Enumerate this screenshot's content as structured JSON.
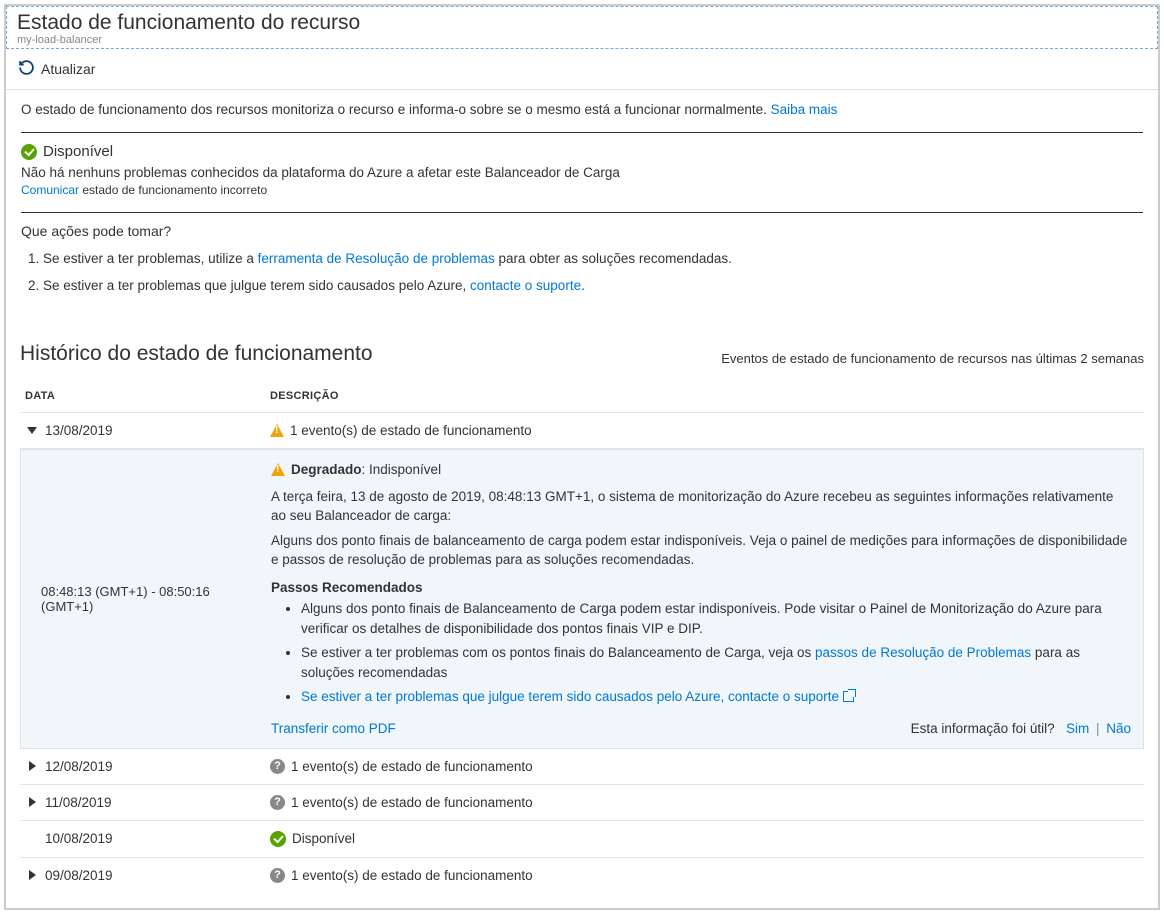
{
  "header": {
    "title": "Estado de funcionamento do recurso",
    "subtitle": "my-load-balancer"
  },
  "toolbar": {
    "refresh": "Atualizar"
  },
  "intro": {
    "text": "O estado de funcionamento dos recursos monitoriza o recurso e informa-o sobre se o mesmo está a funcionar normalmente. ",
    "learn_more": "Saiba mais"
  },
  "status": {
    "label": "Disponível",
    "description": "Não há nenhuns problemas conhecidos da plataforma do Azure a afetar este Balanceador de Carga",
    "report_link": "Comunicar",
    "report_suffix": " estado de funcionamento incorreto"
  },
  "actions": {
    "question": "Que ações pode tomar?",
    "items": [
      {
        "prefix": "Se estiver a ter problemas, utilize a ",
        "link": "ferramenta de Resolução de problemas",
        "suffix": " para obter as soluções recomendadas."
      },
      {
        "prefix": "Se estiver a ter problemas que julgue terem sido causados pelo Azure, ",
        "link": "contacte o suporte",
        "suffix": "."
      }
    ]
  },
  "history": {
    "title": "Histórico do estado de funcionamento",
    "subtitle": "Eventos de estado de funcionamento de recursos nas últimas 2 semanas",
    "cols": {
      "date": "DATA",
      "desc": "DESCRIÇÃO"
    },
    "rows": [
      {
        "date": "13/08/2019",
        "desc": "1 evento(s) de estado de funcionamento",
        "icon": "warn",
        "expanded": true
      },
      {
        "date": "12/08/2019",
        "desc": "1 evento(s) de estado de funcionamento",
        "icon": "unknown",
        "expanded": false
      },
      {
        "date": "11/08/2019",
        "desc": "1 evento(s) de estado de funcionamento",
        "icon": "unknown",
        "expanded": false
      },
      {
        "date": "10/08/2019",
        "desc": "Disponível",
        "icon": "check",
        "expanded": false,
        "no_expander": true
      },
      {
        "date": "09/08/2019",
        "desc": "1 evento(s) de estado de funcionamento",
        "icon": "unknown",
        "expanded": false
      }
    ]
  },
  "detail": {
    "timerange": "08:48:13 (GMT+1) - 08:50:16 (GMT+1)",
    "title_bold": "Degradado",
    "title_suffix": ": Indisponível",
    "p1": "A terça feira, 13 de agosto de 2019, 08:48:13 GMT+1, o sistema de monitorização do Azure recebeu as seguintes informações relativamente ao seu Balanceador de carga:",
    "p2": "Alguns dos ponto finais de balanceamento de carga podem estar indisponíveis. Veja o painel de medições para informações de disponibilidade e passos de resolução de problemas para as soluções recomendadas.",
    "steps_title": "Passos Recomendados",
    "step1": "Alguns dos ponto finais de Balanceamento de Carga podem estar indisponíveis. Pode visitar o Painel de Monitorização do Azure para verificar os detalhes de disponibilidade dos pontos finais VIP e DIP.",
    "step2_prefix": "Se estiver a ter problemas com os pontos finais do Balanceamento de Carga, veja os ",
    "step2_link": "passos de Resolução de Problemas",
    "step2_suffix": " para as soluções recomendadas",
    "step3_link": "Se estiver a ter problemas que julgue terem sido causados pelo Azure, contacte o suporte",
    "download_pdf": "Transferir como PDF",
    "feedback_q": "Esta informação foi útil?",
    "yes": "Sim",
    "no": "Não"
  }
}
